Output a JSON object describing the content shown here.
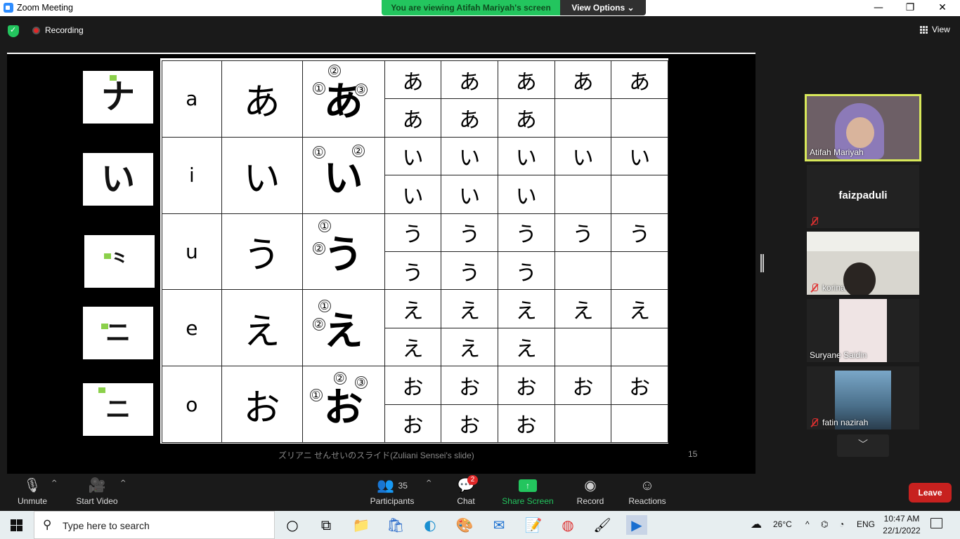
{
  "window": {
    "title": "Zoom Meeting"
  },
  "banner": {
    "message": "You are viewing Atifah Mariyah's screen",
    "options_label": "View Options"
  },
  "topbar": {
    "recording_label": "Recording",
    "view_label": "View"
  },
  "slide": {
    "stroke_cards": [
      "ナ",
      "い",
      "⺀",
      "ニ",
      "ニ"
    ],
    "rows": [
      {
        "romaji": "a",
        "kana": "あ",
        "order_nums": [
          "②",
          "①",
          "③"
        ],
        "practice": [
          "あ",
          "あ",
          "あ",
          "あ",
          "あ",
          "あ",
          "あ",
          "あ"
        ]
      },
      {
        "romaji": "i",
        "kana": "い",
        "order_nums": [
          "①",
          "②"
        ],
        "practice": [
          "い",
          "い",
          "い",
          "い",
          "い",
          "い",
          "い",
          "い"
        ]
      },
      {
        "romaji": "u",
        "kana": "う",
        "order_nums": [
          "①",
          "②"
        ],
        "practice": [
          "う",
          "う",
          "う",
          "う",
          "う",
          "う",
          "う",
          "う"
        ]
      },
      {
        "romaji": "e",
        "kana": "え",
        "order_nums": [
          "①",
          "②"
        ],
        "practice": [
          "え",
          "え",
          "え",
          "え",
          "え",
          "え",
          "え",
          "え"
        ]
      },
      {
        "romaji": "o",
        "kana": "お",
        "order_nums": [
          "②",
          "③",
          "①"
        ],
        "practice": [
          "お",
          "お",
          "お",
          "お",
          "お",
          "お",
          "お",
          "お"
        ]
      }
    ],
    "caption": "ズリアニ せんせいのスライド(Zuliani Sensei's slide)",
    "page_number": "15"
  },
  "participants_panel": {
    "tiles": [
      {
        "name": "Atifah Mariyah",
        "muted": false,
        "active": true
      },
      {
        "name": "faizpaduli",
        "muted": true,
        "active": false
      },
      {
        "name": "korina",
        "muted": true,
        "active": false
      },
      {
        "name": "Suryane Saidin",
        "muted": false,
        "active": false
      },
      {
        "name": "fatin nazirah",
        "muted": true,
        "active": false
      }
    ]
  },
  "toolbar": {
    "unmute": "Unmute",
    "start_video": "Start Video",
    "participants": "Participants",
    "participants_count": "35",
    "chat": "Chat",
    "chat_badge": "2",
    "share_screen": "Share Screen",
    "record": "Record",
    "reactions": "Reactions",
    "leave": "Leave"
  },
  "taskbar": {
    "search_placeholder": "Type here to search",
    "weather": "26°C",
    "lang": "ENG",
    "time": "10:47 AM",
    "date": "22/1/2022"
  }
}
